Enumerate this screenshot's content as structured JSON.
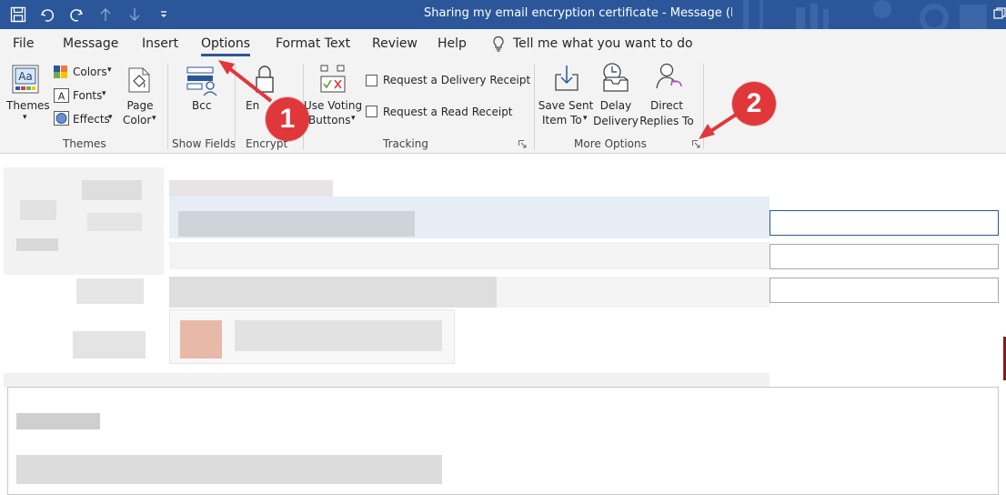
{
  "window": {
    "title": "Sharing my email encryption certificate  -  Message (HTML)"
  },
  "quick_access": {
    "items": [
      "save-icon",
      "undo-icon",
      "redo-icon",
      "up-arrow-icon",
      "down-arrow-icon",
      "customize-qat-icon"
    ]
  },
  "tabs": {
    "items": [
      {
        "label": "File"
      },
      {
        "label": "Message"
      },
      {
        "label": "Insert"
      },
      {
        "label": "Options"
      },
      {
        "label": "Format Text"
      },
      {
        "label": "Review"
      },
      {
        "label": "Help"
      }
    ],
    "active": "Options",
    "tell_me": "Tell me what you want to do"
  },
  "ribbon": {
    "themes": {
      "themes_label": "Themes",
      "colors_label": "Colors",
      "fonts_label": "Fonts",
      "effects_label": "Effects",
      "page_color_line1": "Page",
      "page_color_line2": "Color",
      "group_label": "Themes"
    },
    "show_fields": {
      "bcc_label": "Bcc",
      "group_label": "Show Fields"
    },
    "encrypt": {
      "encrypt_label": "En",
      "group_label": "Encrypt"
    },
    "tracking": {
      "voting_line1": "Use Voting",
      "voting_line2": "Buttons",
      "delivery_receipt": "Request a Delivery Receipt",
      "read_receipt": "Request a Read Receipt",
      "group_label": "Tracking"
    },
    "more_options": {
      "save_sent_line1": "Save Sent",
      "save_sent_line2": "Item To",
      "delay_line1": "Delay",
      "delay_line2": "Delivery",
      "direct_line1": "Direct",
      "direct_line2": "Replies To",
      "group_label": "More Options"
    }
  },
  "annotations": {
    "step1": "1",
    "step2": "2",
    "color": "#e0383a"
  },
  "colors": {
    "titlebar": "#2b579a",
    "ribbon": "#f3f3f3",
    "accent": "#2b579a"
  }
}
